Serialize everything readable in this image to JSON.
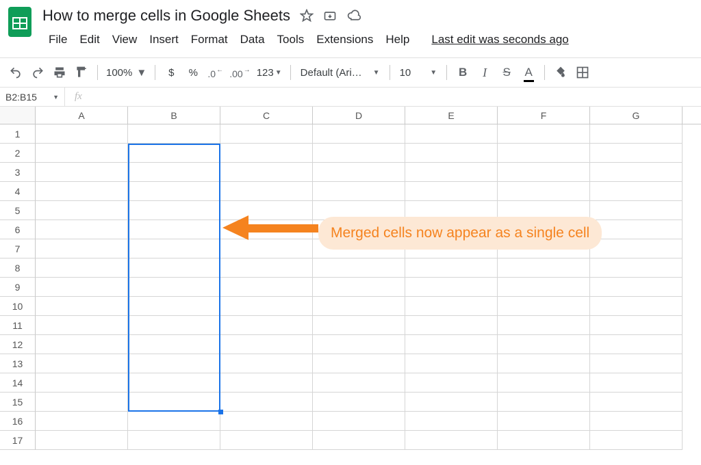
{
  "doc": {
    "title": "How to merge cells in Google Sheets",
    "last_edit": "Last edit was seconds ago"
  },
  "menus": {
    "file": "File",
    "edit": "Edit",
    "view": "View",
    "insert": "Insert",
    "format": "Format",
    "data": "Data",
    "tools": "Tools",
    "extensions": "Extensions",
    "help": "Help"
  },
  "toolbar": {
    "zoom": "100%",
    "currency": "$",
    "percent": "%",
    "dec_dec": ".0",
    "dec_inc": ".00",
    "numfmt": "123",
    "font": "Default (Ari…",
    "fontsize": "10",
    "bold": "B",
    "italic": "I",
    "strike": "S",
    "textcolor": "A"
  },
  "fx": {
    "namebox": "B2:B15",
    "label": "fx",
    "value": ""
  },
  "columns": [
    "A",
    "B",
    "C",
    "D",
    "E",
    "F",
    "G"
  ],
  "rows": [
    "1",
    "2",
    "3",
    "4",
    "5",
    "6",
    "7",
    "8",
    "9",
    "10",
    "11",
    "12",
    "13",
    "14",
    "15",
    "16",
    "17"
  ],
  "selection": {
    "range": "B2:B15"
  },
  "annotation": {
    "text": "Merged cells now appear as a single cell"
  },
  "colors": {
    "selection": "#1a73e8",
    "annotation": "#f5831f"
  }
}
